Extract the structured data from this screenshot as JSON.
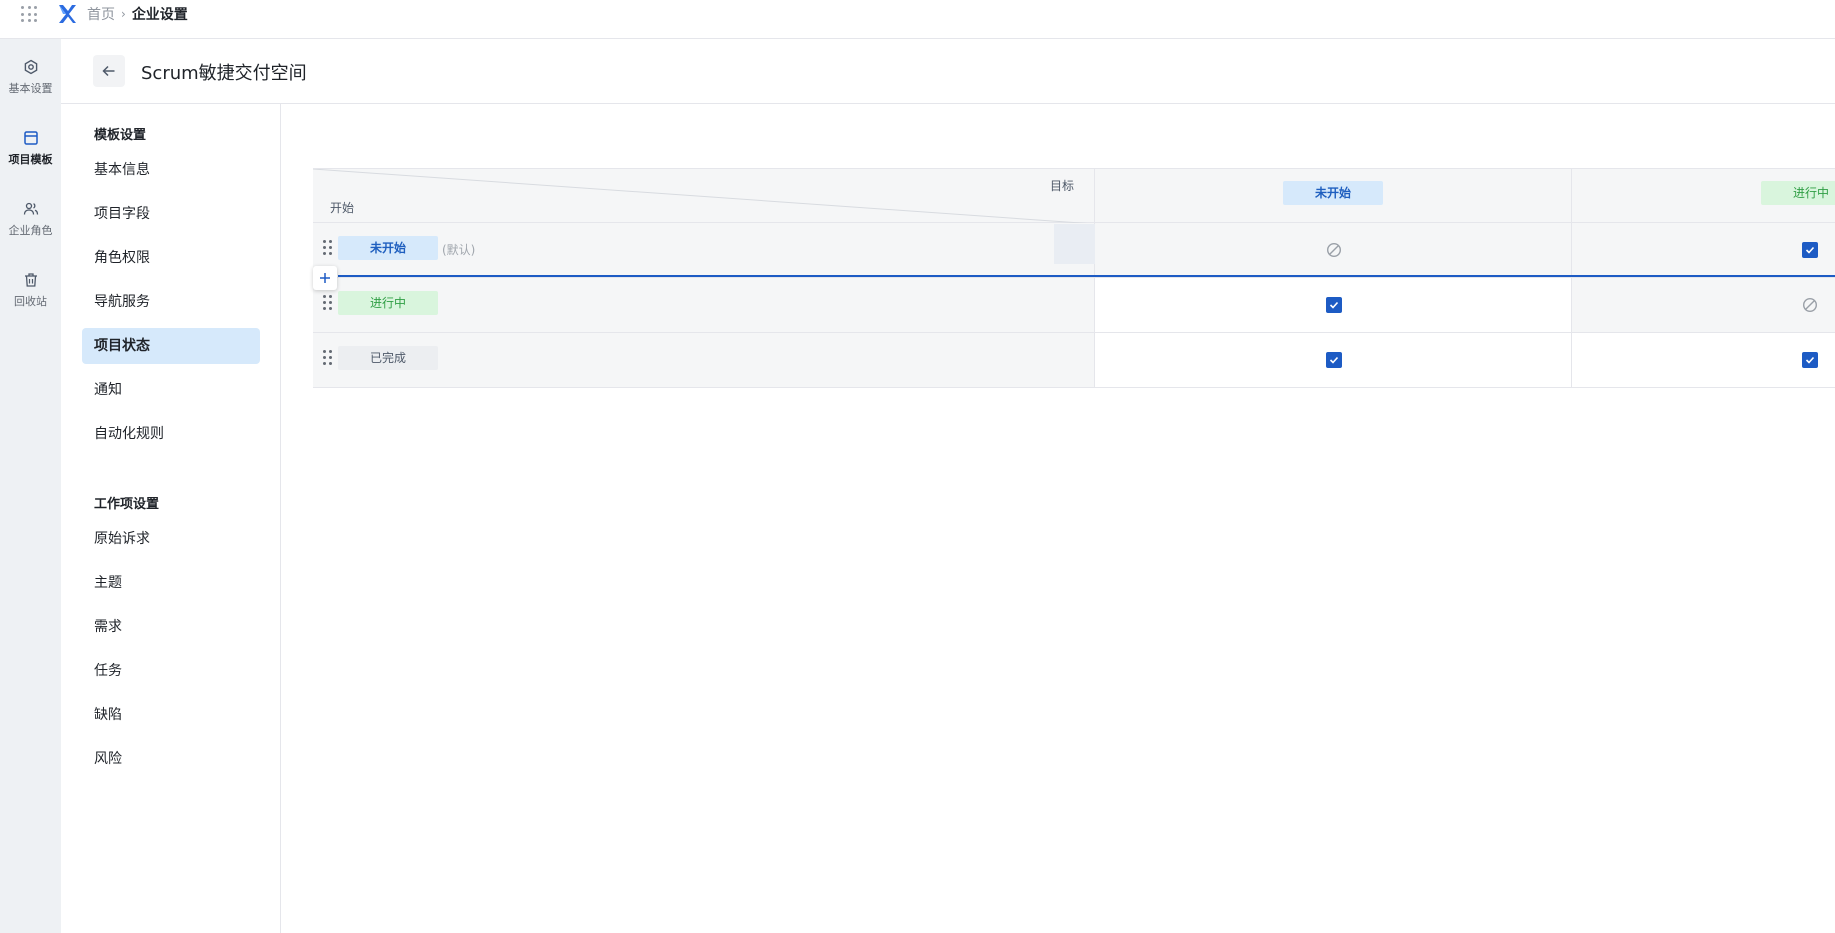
{
  "breadcrumb": {
    "home": "首页",
    "separator": "›",
    "current": "企业设置"
  },
  "rail": [
    {
      "label": "基本设置",
      "icon": "settings-icon",
      "active": false
    },
    {
      "label": "项目模板",
      "icon": "template-icon",
      "active": true
    },
    {
      "label": "企业角色",
      "icon": "users-icon",
      "active": false
    },
    {
      "label": "回收站",
      "icon": "trash-icon",
      "active": false
    }
  ],
  "page": {
    "title": "Scrum敏捷交付空间"
  },
  "menu": {
    "group1_title": "模板设置",
    "group1_items": [
      "基本信息",
      "项目字段",
      "角色权限",
      "导航服务",
      "项目状态",
      "通知",
      "自动化规则"
    ],
    "active_item": "项目状态",
    "group2_title": "工作项设置",
    "group2_items": [
      "原始诉求",
      "主题",
      "需求",
      "任务",
      "缺陷",
      "风险"
    ]
  },
  "matrix": {
    "corner_target": "目标",
    "corner_start": "开始",
    "columns": [
      {
        "label": "未开始",
        "style": "blue"
      },
      {
        "label": "进行中",
        "style": "green"
      }
    ],
    "rows": [
      {
        "label": "未开始",
        "style": "blue",
        "note": "(默认)",
        "cells": [
          "disabled",
          "checked"
        ]
      },
      {
        "label": "进行中",
        "style": "green",
        "note": "",
        "cells": [
          "checked",
          "disabled"
        ]
      },
      {
        "label": "已完成",
        "style": "gray",
        "note": "",
        "cells": [
          "checked",
          "checked"
        ]
      }
    ]
  },
  "colors": {
    "accent": "#1d5bc4",
    "active_bg": "#d6e9fb",
    "rail_bg": "#eef1f4"
  }
}
